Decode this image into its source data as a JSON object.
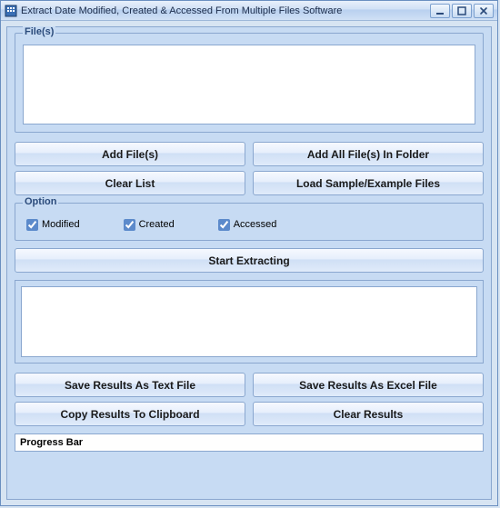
{
  "window": {
    "title": "Extract Date Modified, Created & Accessed From Multiple Files Software"
  },
  "fileGroup": {
    "label": "File(s)"
  },
  "buttons": {
    "addFiles": "Add File(s)",
    "addFolder": "Add All File(s) In Folder",
    "clearList": "Clear List",
    "loadSample": "Load Sample/Example Files",
    "start": "Start Extracting",
    "saveText": "Save Results As Text File",
    "saveExcel": "Save Results As Excel File",
    "copy": "Copy Results To Clipboard",
    "clearResults": "Clear Results"
  },
  "optionGroup": {
    "label": "Option",
    "modified": "Modified",
    "created": "Created",
    "accessed": "Accessed"
  },
  "progressBar": {
    "text": "Progress Bar"
  }
}
